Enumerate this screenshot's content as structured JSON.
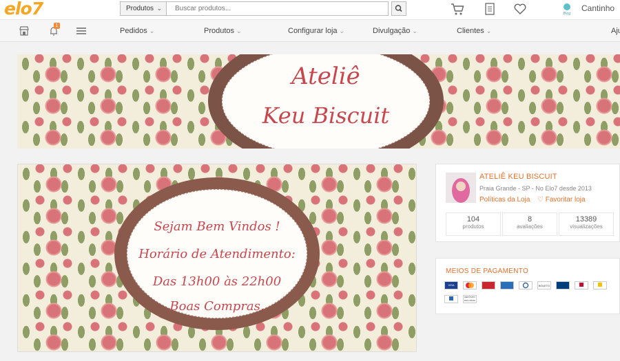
{
  "header": {
    "logo": "elo7",
    "search_category": "Produtos",
    "search_placeholder": "Buscar produtos...",
    "user_name": "Cantinho",
    "blog_badge": "Cantinho do Blog"
  },
  "nav": {
    "notification_count": "1",
    "items": [
      "Pedidos",
      "Produtos",
      "Configurar loja",
      "Divulgação",
      "Clientes"
    ],
    "cut_off": "Aju"
  },
  "banner": {
    "line1": "Ateliê",
    "line2": "Keu Biscuit"
  },
  "promo": {
    "lines": [
      "Sejam Bem Vindos !",
      "Horário de Atendimento:",
      "Das 13h00 às 22h00",
      "Boas Compras."
    ]
  },
  "store": {
    "name": "ATELIÊ KEU BISCUIT",
    "meta": "Praia Grande - SP - No Elo7 desde 2013",
    "policies": "Políticas da Loja",
    "favorite": "Favoritar loja",
    "stats": [
      {
        "value": "104",
        "label": "produtos"
      },
      {
        "value": "8",
        "label": "avaliações"
      },
      {
        "value": "13389",
        "label": "visualizações"
      }
    ]
  },
  "payment": {
    "title": "MEIOS DE PAGAMENTO",
    "methods": [
      "VISA",
      "Mastercard",
      "Hipercard",
      "American Express",
      "Diners",
      "Boleto",
      "Banco do Brasil",
      "Bradesco",
      "Banco do Brasil",
      "Itaú",
      "Depósito em conta"
    ],
    "labels": {
      "boleto": "BOLETO",
      "deposito": "DEPÓSITO EM CONTA"
    }
  },
  "colors": {
    "accent": "#e0712c",
    "logo": "#f5a623",
    "plaque": "#7b5347",
    "script": "#c6474e"
  }
}
